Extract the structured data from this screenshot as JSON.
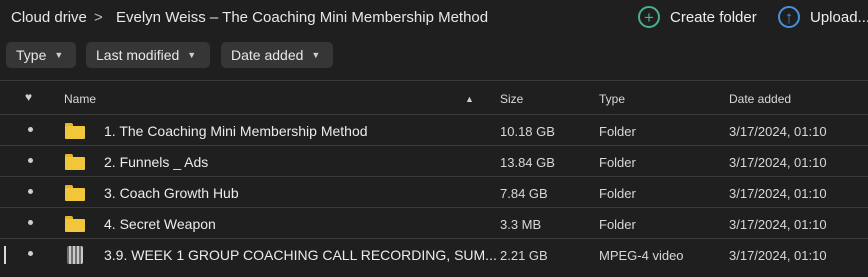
{
  "breadcrumb": {
    "root": "Cloud drive",
    "separator": ">",
    "current": "Evelyn Weiss – The Coaching Mini Membership Method"
  },
  "actions": {
    "create_folder_label": "Create folder",
    "create_folder_icon": "+",
    "upload_label": "Upload...",
    "upload_icon": "↑"
  },
  "filters": [
    {
      "label": "Type"
    },
    {
      "label": "Last modified"
    },
    {
      "label": "Date added"
    }
  ],
  "columns": {
    "favorite_icon": "♥",
    "name": "Name",
    "sort_indicator": "▲",
    "size": "Size",
    "type": "Type",
    "date_added": "Date added"
  },
  "rows": [
    {
      "icon": "folder-icon",
      "name": "1. The Coaching Mini Membership Method",
      "size": "10.18 GB",
      "type": "Folder",
      "date_added": "3/17/2024, 01:10"
    },
    {
      "icon": "folder-icon",
      "name": "2. Funnels _ Ads",
      "size": "13.84 GB",
      "type": "Folder",
      "date_added": "3/17/2024, 01:10"
    },
    {
      "icon": "folder-icon",
      "name": "3. Coach Growth Hub",
      "size": "7.84 GB",
      "type": "Folder",
      "date_added": "3/17/2024, 01:10"
    },
    {
      "icon": "folder-icon",
      "name": "4. Secret Weapon",
      "size": "3.3 MB",
      "type": "Folder",
      "date_added": "3/17/2024, 01:10"
    },
    {
      "icon": "video-thumbnail-icon",
      "name": "3.9. WEEK 1 GROUP COACHING CALL RECORDING, SUM...",
      "size": "2.21 GB",
      "type": "MPEG-4 video",
      "date_added": "3/17/2024, 01:10"
    }
  ],
  "colors": {
    "background": "#1f1f1f",
    "create_folder_accent": "#4ab08e",
    "upload_accent": "#4a90d9",
    "folder": "#f2c63a"
  }
}
